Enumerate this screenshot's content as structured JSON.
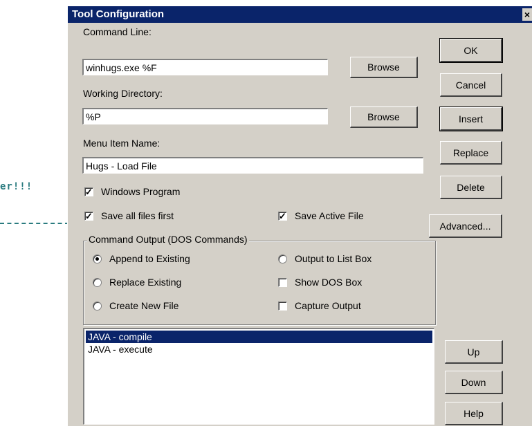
{
  "background": {
    "text": "er!!!"
  },
  "dialog": {
    "title": "Tool Configuration",
    "close_glyph": "×",
    "command_line": {
      "label": "Command Line:",
      "value": "winhugs.exe %F",
      "browse": "Browse"
    },
    "working_directory": {
      "label": "Working Directory:",
      "value": "%P",
      "browse": "Browse"
    },
    "menu_item_name": {
      "label": "Menu Item Name:",
      "value": "Hugs - Load File"
    },
    "checkboxes": {
      "windows_program": {
        "label": "Windows Program",
        "checked": true
      },
      "save_all_files_first": {
        "label": "Save all files first",
        "checked": true
      },
      "save_active_file": {
        "label": "Save Active File",
        "checked": true
      }
    },
    "output_group": {
      "title": "Command Output (DOS Commands)",
      "append_to_existing": "Append to Existing",
      "replace_existing": "Replace Existing",
      "create_new_file": "Create New File",
      "output_to_list_box": "Output to List Box",
      "show_dos_box": "Show DOS Box",
      "capture_output": "Capture Output",
      "selected": "Append to Existing"
    },
    "tools_list": {
      "items": [
        "JAVA - compile",
        "JAVA - execute"
      ],
      "selected_index": 0
    },
    "buttons": {
      "ok": "OK",
      "cancel": "Cancel",
      "insert": "Insert",
      "replace": "Replace",
      "delete": "Delete",
      "advanced": "Advanced...",
      "up": "Up",
      "down": "Down",
      "help": "Help"
    },
    "colors": {
      "titlebar": "#0a246a",
      "face": "#d4d0c8",
      "selection": "#0a246a"
    }
  }
}
